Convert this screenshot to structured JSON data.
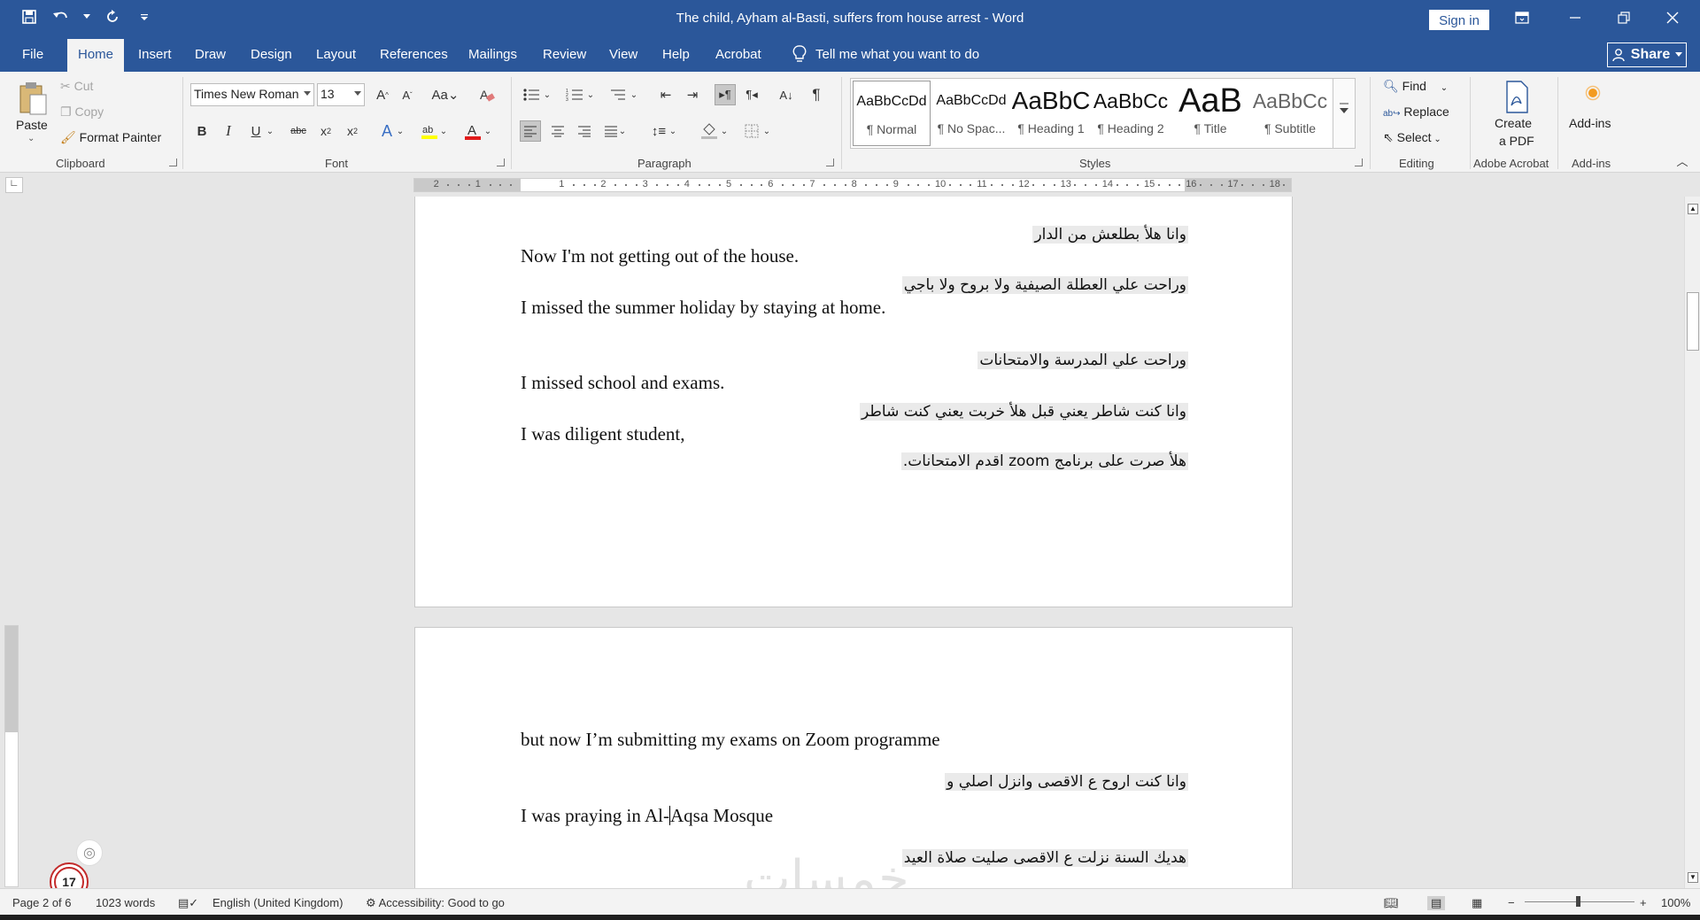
{
  "window": {
    "title": "The child, Ayham al-Basti, suffers from house arrest  -  Word",
    "sign_in": "Sign in",
    "share": "Share"
  },
  "menu_tabs": [
    "File",
    "Home",
    "Insert",
    "Draw",
    "Design",
    "Layout",
    "References",
    "Mailings",
    "Review",
    "View",
    "Help",
    "Acrobat"
  ],
  "active_tab": "Home",
  "tell_me": "Tell me what you want to do",
  "clipboard": {
    "paste": "Paste",
    "cut": "Cut",
    "copy": "Copy",
    "format_painter": "Format Painter",
    "label": "Clipboard"
  },
  "font": {
    "family": "Times New Roman",
    "size": "13",
    "label": "Font"
  },
  "paragraph": {
    "label": "Paragraph"
  },
  "styles": {
    "label": "Styles",
    "items": [
      {
        "sample": "AaBbCcDd",
        "name": "¶ Normal"
      },
      {
        "sample": "AaBbCcDd",
        "name": "¶ No Spac..."
      },
      {
        "sample": "AaBbC",
        "name": "¶ Heading 1"
      },
      {
        "sample": "AaBbCc",
        "name": "¶ Heading 2"
      },
      {
        "sample": "AaB",
        "name": "¶ Title"
      },
      {
        "sample": "AaBbCc",
        "name": "¶ Subtitle"
      }
    ]
  },
  "editing": {
    "find": "Find",
    "replace": "Replace",
    "select": "Select",
    "label": "Editing"
  },
  "acrobat": {
    "create_pdf_line1": "Create",
    "create_pdf_line2": "a PDF",
    "label": "Adobe Acrobat"
  },
  "addins": {
    "button": "Add-ins",
    "label": "Add-ins"
  },
  "ruler_numbers": [
    "2",
    "1",
    "1",
    "2",
    "3",
    "4",
    "5",
    "6",
    "7",
    "8",
    "9",
    "10",
    "11",
    "12",
    "13",
    "14",
    "15",
    "16",
    "17",
    "18"
  ],
  "document": {
    "page1_lines": [
      {
        "lang": "ar",
        "text": "وانا هلأ بطلعش من الدار"
      },
      {
        "lang": "en",
        "text": "Now I'm not getting out of the house."
      },
      {
        "lang": "ar",
        "text": "وراحت علي العطلة الصيفية ولا بروح ولا باجي"
      },
      {
        "lang": "en",
        "text": "I missed the summer holiday by staying at home."
      },
      {
        "lang": "ar",
        "text": "وراحت علي المدرسة والامتحانات"
      },
      {
        "lang": "en",
        "text": "I missed school and exams."
      },
      {
        "lang": "ar",
        "text": "وانا كنت شاطر يعني قبل هلأ خربت يعني كنت شاطر"
      },
      {
        "lang": "en",
        "text": "I was diligent student,"
      },
      {
        "lang": "ar",
        "text": "هلأ صرت على برنامج zoom اقدم الامتحانات."
      }
    ],
    "page2_lines": [
      {
        "lang": "en",
        "text": "but now I’m submitting my exams on Zoom programme"
      },
      {
        "lang": "ar",
        "text": "وانا كنت اروح ع الاقصى وانزل اصلي و"
      },
      {
        "lang": "en",
        "text_before": "I was praying in  Al-",
        "text_after": "Aqsa Mosque"
      },
      {
        "lang": "ar",
        "text": "هديك السنة نزلت ع الاقصى صليت صلاة العيد"
      }
    ]
  },
  "watermark": "خمسات",
  "status": {
    "page": "Page 2 of 6",
    "words": "1023 words",
    "language": "English (United Kingdom)",
    "accessibility": "Accessibility: Good to go",
    "zoom": "100%"
  },
  "badge_number": "17",
  "colors": {
    "accent": "#2b579a",
    "ribbon": "#f3f3f3",
    "canvas": "#e6e6e6",
    "badge_ring": "#c32a2a"
  }
}
